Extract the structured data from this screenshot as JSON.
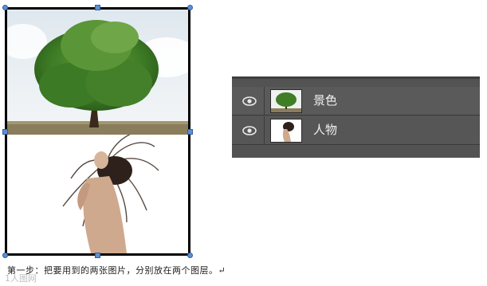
{
  "canvas": {
    "images": [
      {
        "kind": "tree-photo"
      },
      {
        "kind": "dancer-photo"
      }
    ]
  },
  "layers_panel": {
    "layers": [
      {
        "name": "景色",
        "visible": true,
        "thumbnail": "tree"
      },
      {
        "name": "人物",
        "visible": true,
        "thumbnail": "figure"
      }
    ]
  },
  "caption": {
    "text": "第一步：把要用到的两张图片，分别放在两个图层。↵"
  },
  "watermark": {
    "text": "1人图网"
  },
  "icons": {
    "visibility": "eye-icon",
    "selection_handle": "transform-handle"
  },
  "colors": {
    "panel_bg": "#535353",
    "handle": "#5b8fd6",
    "canvas_border": "#000000"
  }
}
